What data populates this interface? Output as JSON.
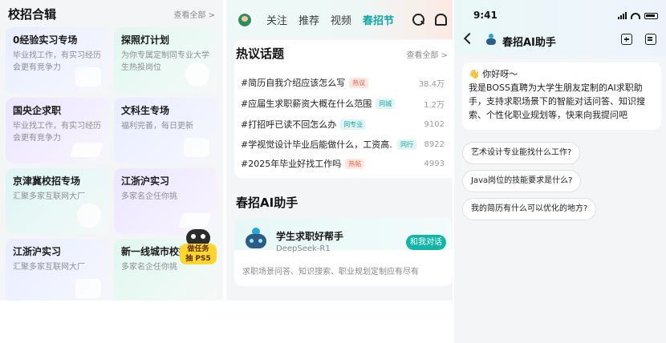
{
  "panel1": {
    "title": "校招合辑",
    "more": "查看全部 >",
    "cards": [
      {
        "title": "0经验实习专场",
        "sub": "毕业找工作，有实习经历会更有竞争力",
        "theme": "blue"
      },
      {
        "title": "探照灯计划",
        "sub": "为你专属定制同专业大学生热投岗位",
        "theme": "green"
      },
      {
        "title": "国央企求职",
        "sub": "毕业找工作，有实习经历会更有竞争力",
        "theme": "purple"
      },
      {
        "title": "文科生专场",
        "sub": "福利完善，每日更新",
        "theme": "blue"
      },
      {
        "title": "京津冀校招专场",
        "sub": "汇聚多家互联网大厂",
        "theme": "teal"
      },
      {
        "title": "江浙沪实习",
        "sub": "多家名企任你挑",
        "theme": "purple"
      },
      {
        "title": "江浙沪实习",
        "sub": "汇聚多家互联网大厂",
        "theme": "blue"
      },
      {
        "title": "新一线城市校招",
        "sub": "多家名企任你挑",
        "theme": "green"
      }
    ],
    "task_badge": {
      "line1": "做任务",
      "line2": "抽 PS5"
    }
  },
  "panel2": {
    "tabs": [
      "关注",
      "推荐",
      "视频",
      "春招节"
    ],
    "active_tab": "春招节",
    "hot": {
      "title": "热议话题",
      "more": "查看全部 >",
      "topics": [
        {
          "text": "#简历自我介绍应该怎么写",
          "tag": "热议",
          "tag_color": "red",
          "count": "38.4万"
        },
        {
          "text": "#应届生求职薪资大概在什么范围",
          "tag": "同城",
          "tag_color": "teal",
          "count": "1.2万"
        },
        {
          "text": "#打招呼已读不回怎么办",
          "tag": "同专业",
          "tag_color": "teal",
          "count": "9102"
        },
        {
          "text": "#学视觉设计毕业后能做什么，工资高...",
          "tag": "同行",
          "tag_color": "teal",
          "count": "8922"
        },
        {
          "text": "#2025年毕业好找工作吗",
          "tag": "热帖",
          "tag_color": "red",
          "count": "4993"
        }
      ]
    },
    "ai": {
      "section_title": "春招AI助手",
      "name": "学生求职好帮手",
      "model": "DeepSeek-R1",
      "button": "和我对话",
      "desc": "求职场景问答、知识搜索、职业规划定制应有尽有"
    }
  },
  "panel3": {
    "time": "9:41",
    "title": "春招AI助手",
    "greeting_hi": "👋 你好呀～",
    "greeting_body": "我是BOSS直聘为大学生朋友定制的AI求职助手，支持求职场景下的智能对话问答、知识搜索、个性化职业规划等，快来向我提问吧",
    "suggestions": [
      "艺术设计专业能找什么工作?",
      "Java岗位的技能要求是什么?",
      "我的简历有什么可以优化的地方?"
    ]
  },
  "colors": {
    "accent": "#12b5a8",
    "active_tab": "#0fa6a6",
    "tag_red": "#ef5b3a",
    "badge_yellow": "#ffd52e"
  }
}
